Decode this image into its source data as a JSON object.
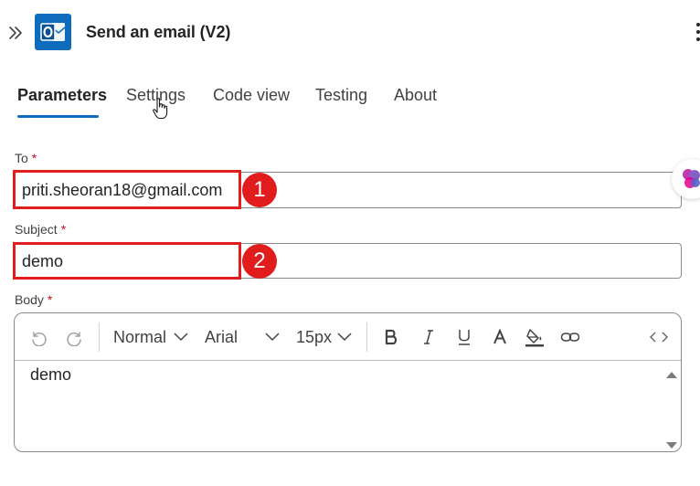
{
  "header": {
    "title": "Send an email (V2)"
  },
  "tabs": [
    {
      "label": "Parameters",
      "active": true
    },
    {
      "label": "Settings",
      "active": false
    },
    {
      "label": "Code view",
      "active": false
    },
    {
      "label": "Testing",
      "active": false
    },
    {
      "label": "About",
      "active": false
    }
  ],
  "fields": {
    "to": {
      "label": "To",
      "required_mark": "*",
      "value": "priti.sheoran18@gmail.com"
    },
    "subject": {
      "label": "Subject",
      "required_mark": "*",
      "value": "demo"
    },
    "body": {
      "label": "Body",
      "required_mark": "*",
      "value": "demo"
    }
  },
  "annotations": {
    "badge1": "1",
    "badge2": "2",
    "highlight_color": "#e01c1c"
  },
  "toolbar": {
    "format": "Normal",
    "font": "Arial",
    "size": "15px"
  },
  "colors": {
    "accent": "#0f6cbd",
    "required": "#c50f1f"
  }
}
